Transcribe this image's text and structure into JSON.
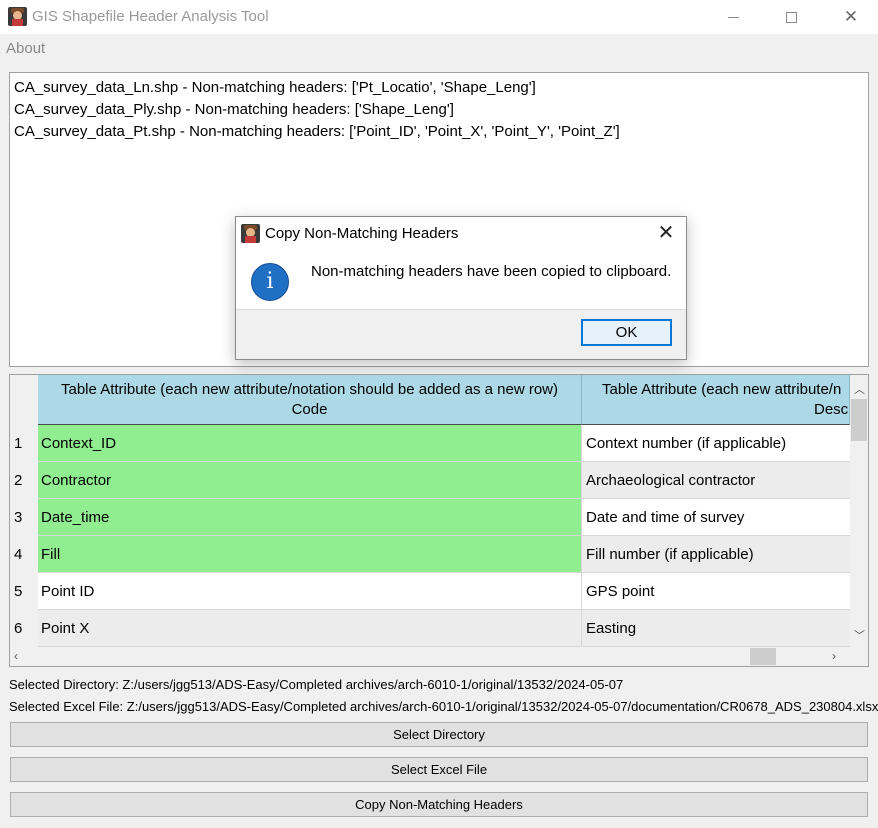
{
  "window": {
    "title": "GIS Shapefile Header Analysis Tool",
    "minimize_label": "",
    "close_glyph": "✕"
  },
  "menu": {
    "about": "About"
  },
  "output_lines": [
    "CA_survey_data_Ln.shp - Non-matching headers: ['Pt_Locatio', 'Shape_Leng']",
    "CA_survey_data_Ply.shp - Non-matching headers: ['Shape_Leng']",
    "CA_survey_data_Pt.shp - Non-matching headers: ['Point_ID', 'Point_X', 'Point_Y', 'Point_Z']"
  ],
  "table": {
    "headers": [
      {
        "line1": "Table Attribute (each new attribute/notation should be added as a new row)",
        "line2": "Code"
      },
      {
        "line1": "Table Attribute (each new attribute/n",
        "line2": "Desc"
      }
    ],
    "rows": [
      {
        "num": "1",
        "code": "Context_ID",
        "desc": "Context number (if applicable)",
        "highlight": true
      },
      {
        "num": "2",
        "code": "Contractor",
        "desc": "Archaeological contractor",
        "highlight": true
      },
      {
        "num": "3",
        "code": "Date_time",
        "desc": "Date and time of survey",
        "highlight": true
      },
      {
        "num": "4",
        "code": "Fill",
        "desc": "Fill number (if applicable)",
        "highlight": true
      },
      {
        "num": "5",
        "code": "Point ID",
        "desc": "GPS point",
        "highlight": false
      },
      {
        "num": "6",
        "code": "Point X",
        "desc": "Easting",
        "highlight": false
      }
    ],
    "highlight_color": "#90ee90",
    "header_color": "#add8e6"
  },
  "info": {
    "selected_directory": "Selected Directory: Z:/users/jgg513/ADS-Easy/Completed archives/arch-6010-1/original/13532/2024-05-07",
    "selected_excel": "Selected Excel File: Z:/users/jgg513/ADS-Easy/Completed archives/arch-6010-1/original/13532/2024-05-07/documentation/CR0678_ADS_230804.xlsx"
  },
  "buttons": {
    "select_directory": "Select Directory",
    "select_excel": "Select Excel File",
    "copy_headers": "Copy Non-Matching Headers"
  },
  "dialog": {
    "title": "Copy Non-Matching Headers",
    "message": "Non-matching headers have been copied to clipboard.",
    "ok": "OK",
    "close_glyph": "✕",
    "icon_glyph": "i"
  },
  "scroll_glyphs": {
    "up": "︿",
    "down": "﹀",
    "left": "‹",
    "right": "›"
  }
}
